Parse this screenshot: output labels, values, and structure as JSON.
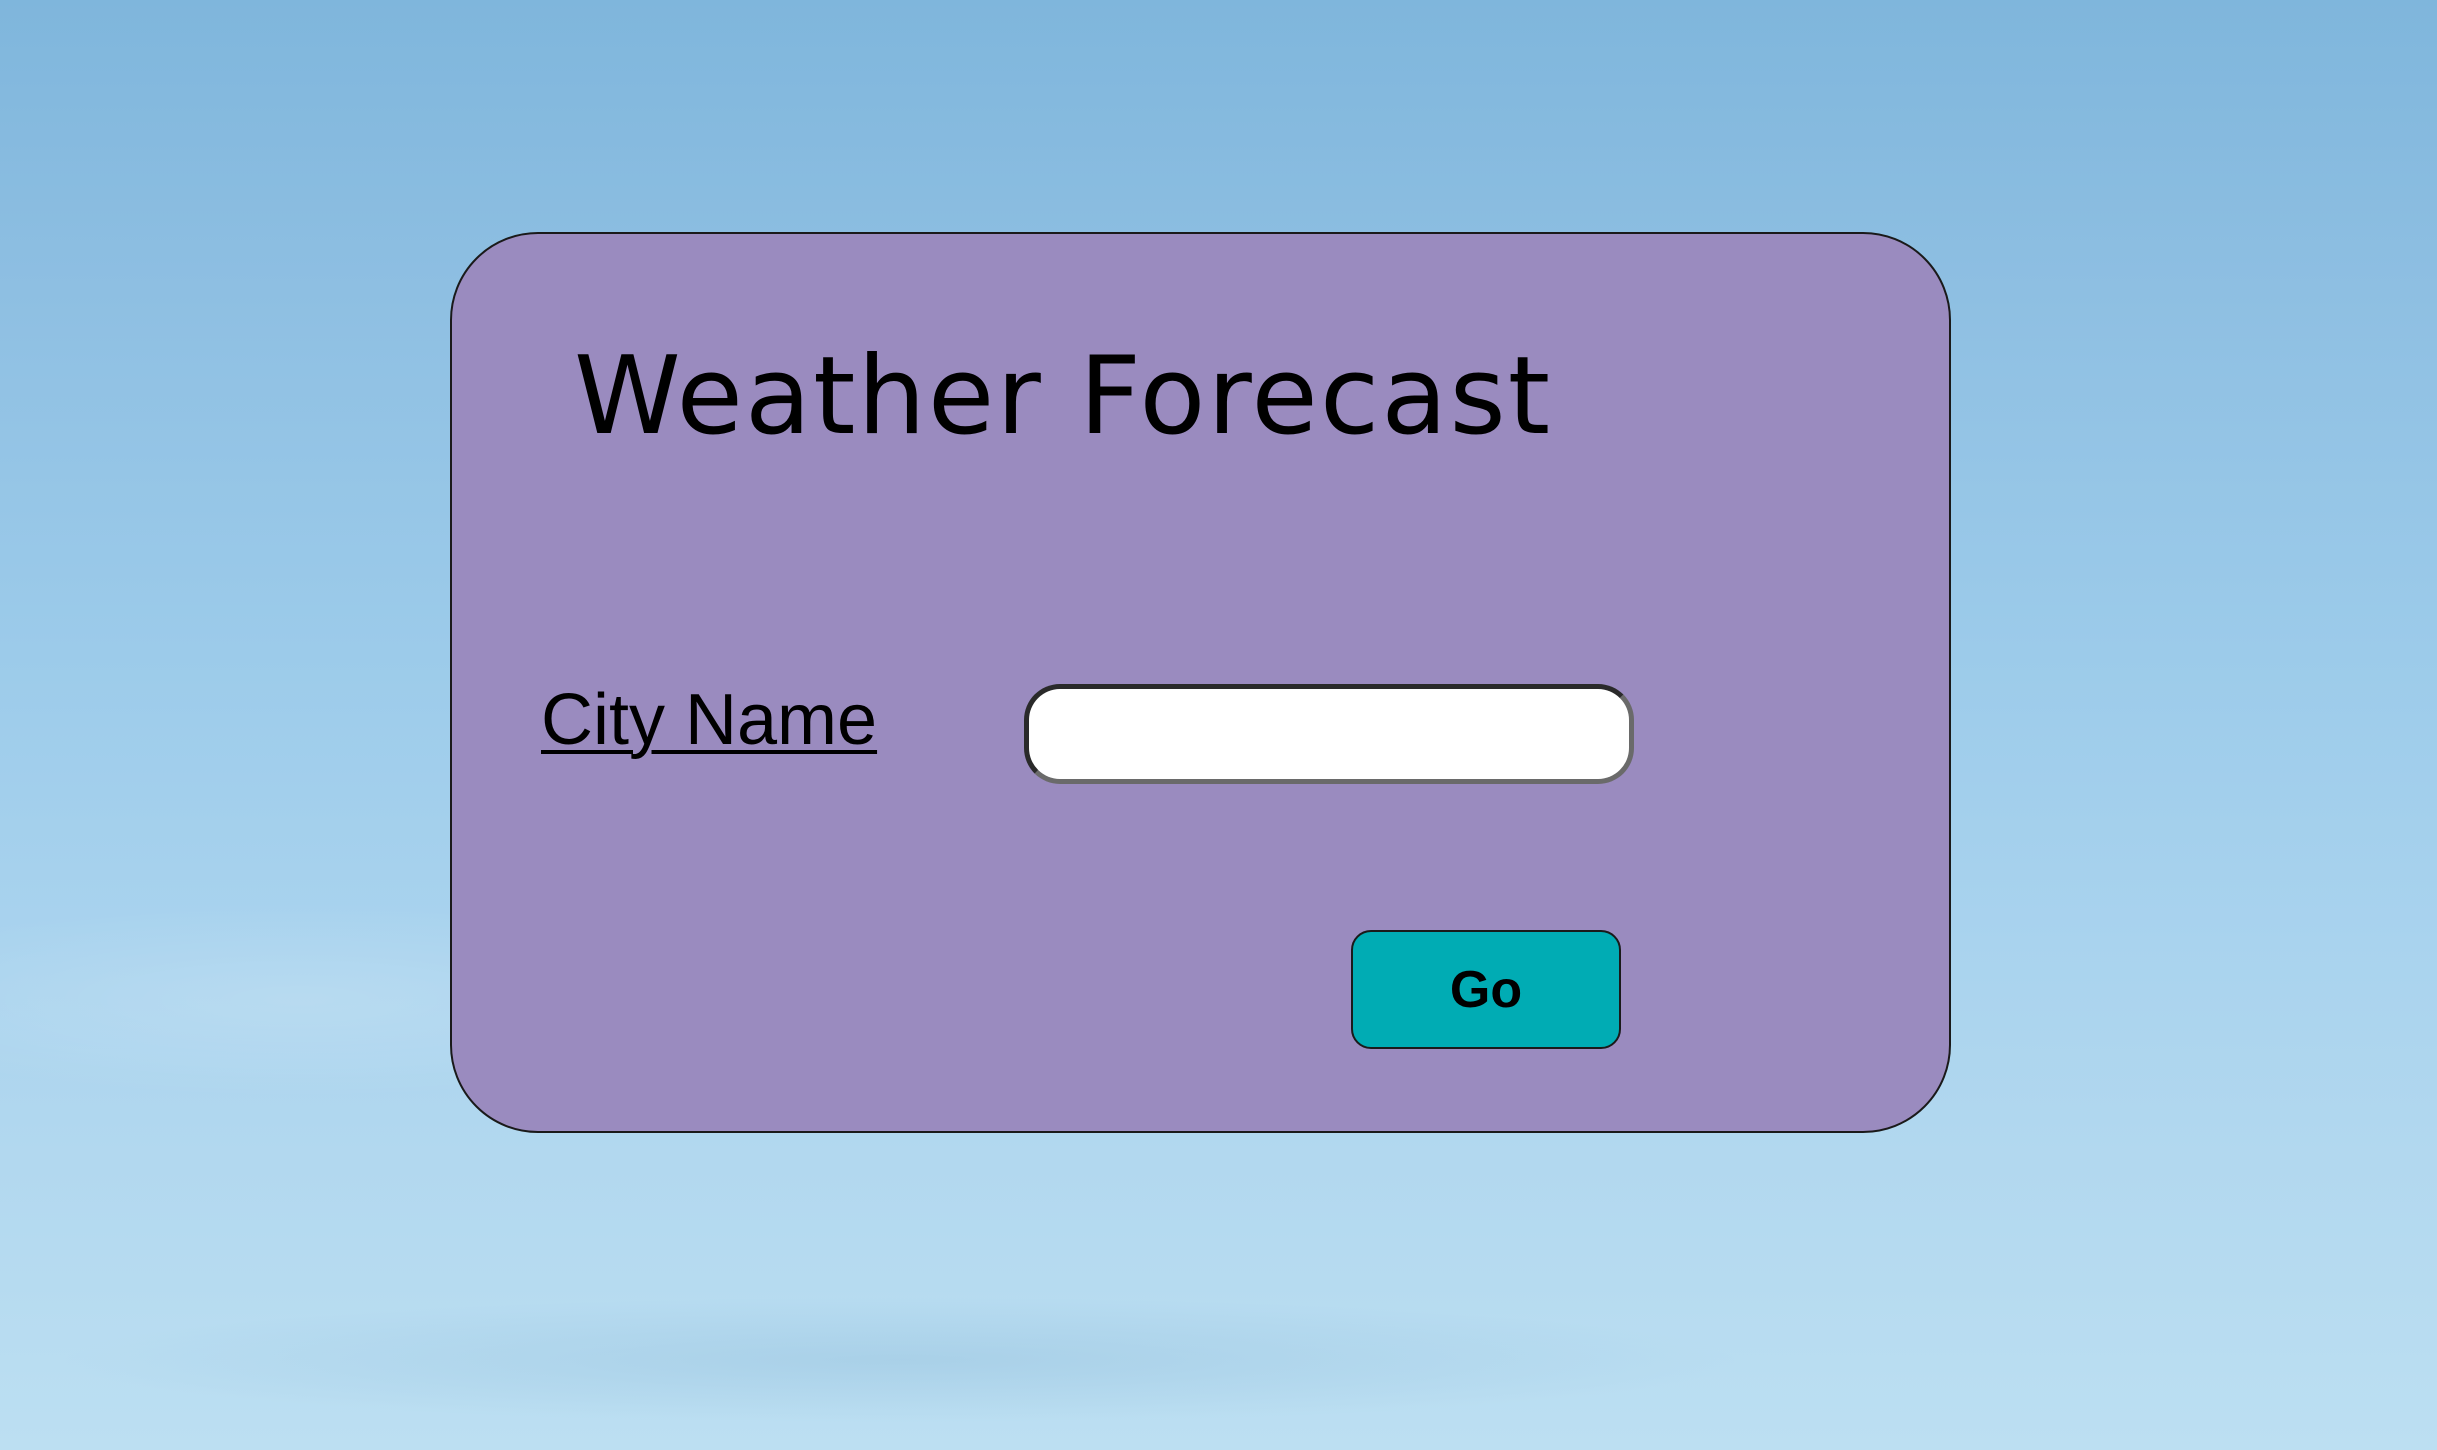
{
  "page": {
    "title": "Weather Forecast"
  },
  "form": {
    "city_label": "City Name",
    "city_input_value": "",
    "city_input_placeholder": "",
    "go_label": "Go"
  },
  "colors": {
    "card_background": "#9a8bbf",
    "button_background": "#00acb4",
    "sky_top": "#7fb6dc",
    "sky_bottom": "#bcdff2"
  }
}
